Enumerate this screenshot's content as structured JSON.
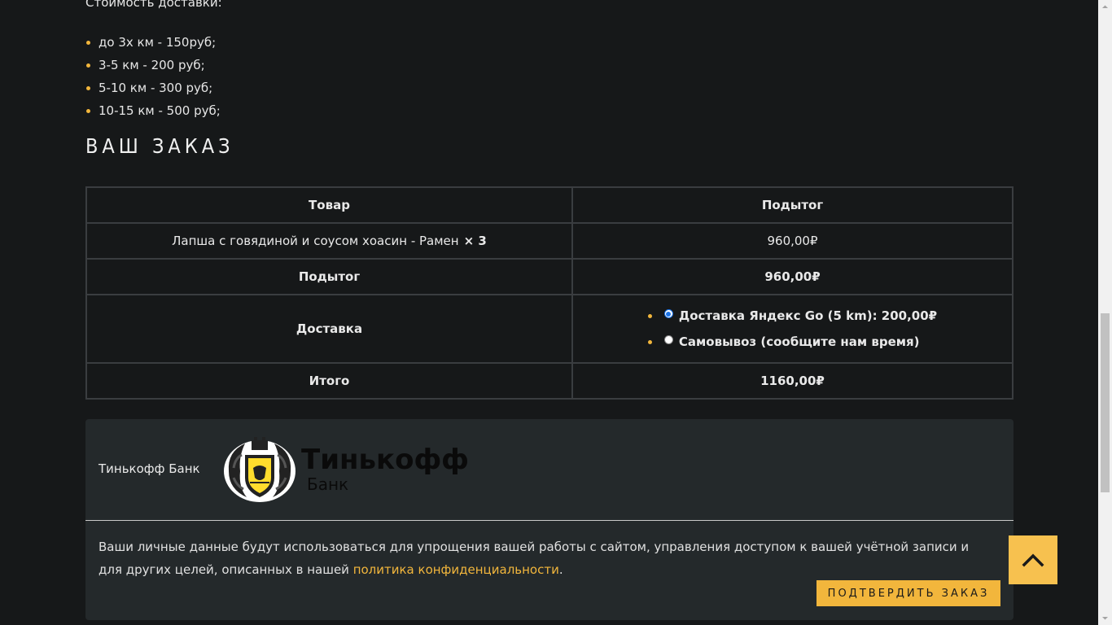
{
  "delivery": {
    "label": "Стоимость доставки:",
    "rates": [
      "до 3х км - 150руб;",
      "3-5 км - 200 руб;",
      "5-10 км - 300 руб;",
      "10-15 км - 500 руб;"
    ]
  },
  "order": {
    "title": "ВАШ ЗАКАЗ",
    "headers": {
      "product": "Товар",
      "subtotal": "Подытог"
    },
    "item": {
      "name": "Лапша с говядиной и соусом хоасин - Рамен",
      "qty": "× 3",
      "price": "960,00₽"
    },
    "subtotal": {
      "label": "Подытог",
      "value": "960,00₽"
    },
    "shipping": {
      "label": "Доставка",
      "options": [
        {
          "label": "Доставка Яндекс Go (5 km): 200,00₽",
          "selected": true
        },
        {
          "label": "Самовывоз (сообщите нам время)",
          "selected": false
        }
      ]
    },
    "total": {
      "label": "Итого",
      "value": "1160,00₽"
    }
  },
  "payment": {
    "method_label": "Тинькофф Банк",
    "logo": {
      "title": "Тинькофф",
      "subtitle": "Банк",
      "icon": "tinkoff-crest-icon"
    },
    "privacy_text": "Ваши личные данные будут использоваться для упрощения вашей работы с сайтом, управления доступом к вашей учётной записи и для других целей, описанных в нашей ",
    "privacy_link": "политика конфиденциальности",
    "privacy_end": ".",
    "confirm_label": "ПОДТВЕРДИТЬ ЗАКАЗ"
  },
  "colors": {
    "accent": "#f2b63c",
    "background": "#161819",
    "panel": "#24292b"
  },
  "icons": {
    "scroll_top": "chevron-up-icon"
  }
}
